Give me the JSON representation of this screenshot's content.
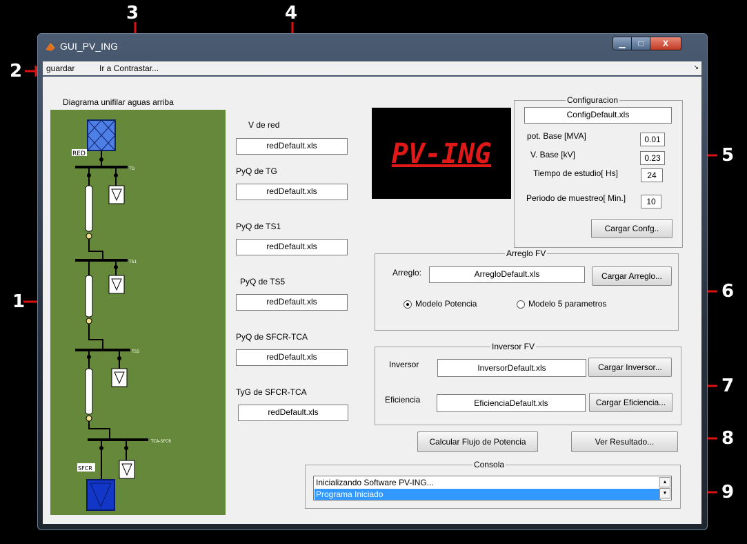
{
  "annotations": [
    "1",
    "2",
    "3",
    "4",
    "5",
    "6",
    "7",
    "8",
    "9"
  ],
  "window": {
    "title": "GUI_PV_ING",
    "min_glyph": "▁",
    "max_glyph": "□",
    "close_glyph": "X"
  },
  "menu": {
    "items": [
      "guardar",
      "Ir a Contrastar..."
    ],
    "overflow_glyph": "↘"
  },
  "diagram": {
    "title": "Diagrama unifilar aguas arriba",
    "labels": {
      "red": "RED",
      "tg": "TG",
      "ts1": "TS1",
      "ts5": "TS5",
      "tca": "TCA-SFCR",
      "sfcr": "SFCR"
    },
    "colors": {
      "background": "#66883a",
      "source": "#4d7fe6",
      "sfcr": "#1236c8"
    }
  },
  "inputs": [
    {
      "label": "V de red",
      "value": "redDefault.xls"
    },
    {
      "label": "PyQ de TG",
      "value": "redDefault.xls"
    },
    {
      "label": "PyQ de TS1",
      "value": "redDefault.xls"
    },
    {
      "label": "PyQ de TS5",
      "value": "redDefault.xls"
    },
    {
      "label": "PyQ de SFCR-TCA",
      "value": "redDefault.xls"
    },
    {
      "label": "TyG de SFCR-TCA",
      "value": "redDefault.xls"
    }
  ],
  "logo": {
    "text": "PV-ING",
    "color": "#e01818"
  },
  "config": {
    "title": "Configuracion",
    "file": "ConfigDefault.xls",
    "params": [
      {
        "label": "pot. Base [MVA]",
        "value": "0.01"
      },
      {
        "label": "V. Base [kV]",
        "value": "0.23"
      },
      {
        "label": "Tiempo de estudio[ Hs]",
        "value": "24"
      },
      {
        "label": "Periodo de muestreo[ Min.]",
        "value": "10"
      }
    ],
    "load_button": "Cargar Confg.."
  },
  "arreglo": {
    "title": "Arreglo FV",
    "label": "Arreglo:",
    "file": "ArregloDefault.xls",
    "load_button": "Cargar Arreglo...",
    "radio_options": [
      "Modelo Potencia",
      "Modelo 5 parametros"
    ],
    "selected_option": "Modelo Potencia"
  },
  "inversor": {
    "title": "Inversor FV",
    "inversor_label": "Inversor",
    "inversor_file": "InversorDefault.xls",
    "inversor_button": "Cargar Inversor...",
    "eficiencia_label": "Eficiencia",
    "eficiencia_file": "EficienciaDefault.xls",
    "eficiencia_button": "Cargar Eficiencia..."
  },
  "actions": {
    "calculate": "Calcular Flujo de Potencia",
    "results": "Ver Resultado..."
  },
  "console": {
    "title": "Consola",
    "lines": [
      "Inicializando Software PV-ING...",
      "Programa Iniciado"
    ],
    "selected_index": 1
  }
}
